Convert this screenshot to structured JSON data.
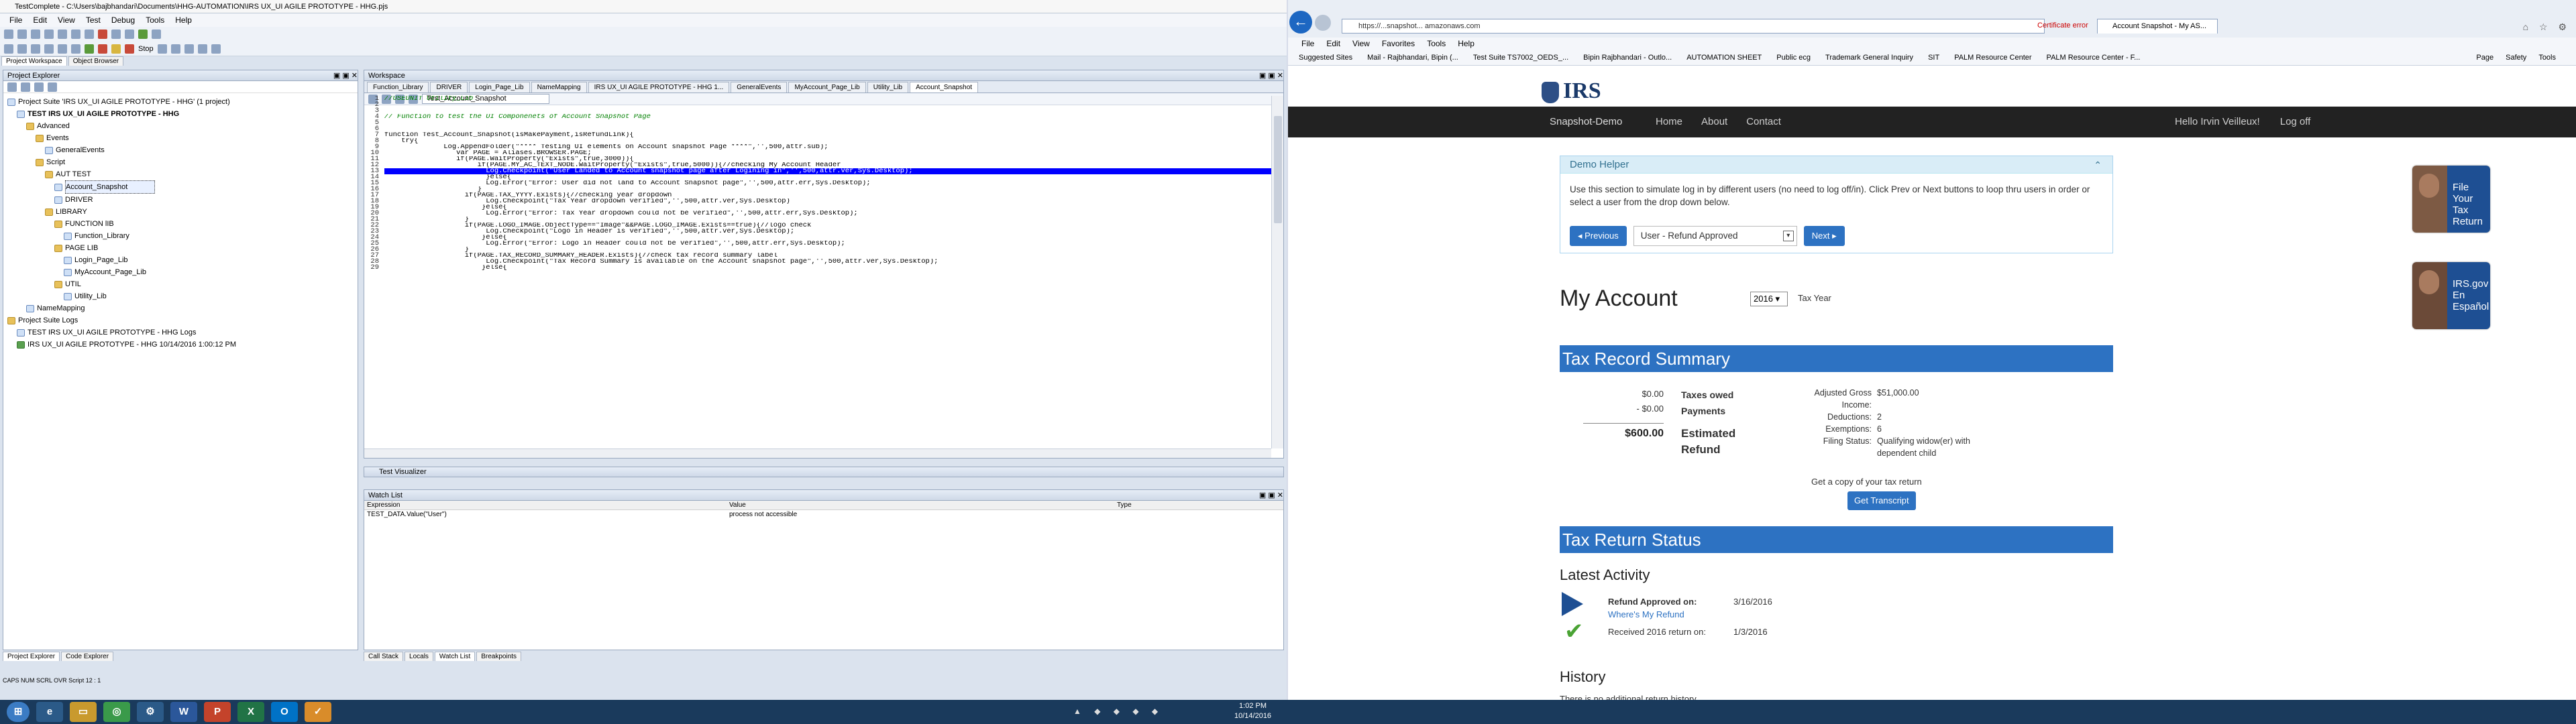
{
  "testcomplete": {
    "title": "TestComplete - C:\\Users\\bajbhandari\\Documents\\HHG-AUTOMATION\\IRS UX_UI AGILE PROTOTYPE - HHG.pjs",
    "menu": [
      "File",
      "Edit",
      "View",
      "Test",
      "Debug",
      "Tools",
      "Help"
    ],
    "stop_label": "Stop",
    "pane_tabs": [
      "Project Workspace",
      "Object Browser"
    ],
    "explorer": {
      "title": "Project Explorer",
      "tree": [
        {
          "label": "Project Suite 'IRS UX_UI AGILE PROTOTYPE - HHG' (1 project)",
          "depth": 0,
          "type": "f"
        },
        {
          "label": "TEST IRS UX_UI AGILE PROTOTYPE - HHG",
          "depth": 1,
          "type": "f",
          "bold": true
        },
        {
          "label": "Advanced",
          "depth": 2,
          "type": "d"
        },
        {
          "label": "Events",
          "depth": 3,
          "type": "d"
        },
        {
          "label": "GeneralEvents",
          "depth": 4,
          "type": "f"
        },
        {
          "label": "Script",
          "depth": 3,
          "type": "d"
        },
        {
          "label": "AUT TEST",
          "depth": 4,
          "type": "d"
        },
        {
          "label": "Account_Snapshot",
          "depth": 5,
          "type": "f",
          "selected": true
        },
        {
          "label": "DRIVER",
          "depth": 5,
          "type": "f"
        },
        {
          "label": "LIBRARY",
          "depth": 4,
          "type": "d"
        },
        {
          "label": "FUNCTION lIB",
          "depth": 5,
          "type": "d"
        },
        {
          "label": "Function_Library",
          "depth": 6,
          "type": "f"
        },
        {
          "label": "PAGE LIB",
          "depth": 5,
          "type": "d"
        },
        {
          "label": "Login_Page_Lib",
          "depth": 6,
          "type": "f"
        },
        {
          "label": "MyAccount_Page_Lib",
          "depth": 6,
          "type": "f"
        },
        {
          "label": "UTIL",
          "depth": 5,
          "type": "d"
        },
        {
          "label": "Utility_Lib",
          "depth": 6,
          "type": "f"
        },
        {
          "label": "NameMapping",
          "depth": 2,
          "type": "f"
        },
        {
          "label": "Project Suite Logs",
          "depth": 0,
          "type": "d"
        },
        {
          "label": "TEST IRS UX_UI AGILE PROTOTYPE - HHG Logs",
          "depth": 1,
          "type": "f"
        },
        {
          "label": "IRS UX_UI AGILE PROTOTYPE - HHG 10/14/2016 1:00:12 PM",
          "depth": 1,
          "type": "t"
        }
      ],
      "footer_tabs": [
        "Project Explorer",
        "Code Explorer"
      ]
    },
    "workspace": {
      "title": "Workspace",
      "tabs": [
        "Function_Library",
        "DRIVER",
        "Login_Page_Lib",
        "NameMapping",
        "IRS UX_UI AGILE PROTOTYPE - HHG 1...",
        "GeneralEvents",
        "MyAccount_Page_Lib",
        "Utility_Lib",
        "Account_Snapshot"
      ],
      "routine": "Test_Account_Snapshot",
      "code": [
        {
          "n": "1",
          "t": "//USEUNIT Utility_Lib",
          "c": true
        },
        {
          "n": "2",
          "t": ""
        },
        {
          "n": "3",
          "t": ""
        },
        {
          "n": "4",
          "t": "// Function to test the UI Componenets of Account Snapshot Page",
          "c": true
        },
        {
          "n": "5",
          "t": ""
        },
        {
          "n": "6",
          "t": ""
        },
        {
          "n": "7",
          "t": "function Test_Account_Snapshot(isMakePayment,isRefundLink){"
        },
        {
          "n": "8",
          "t": "    try{"
        },
        {
          "n": "9",
          "t": "              Log.AppendFolder(\"**** Testing UI elements on Account snapshot Page ****\",'',500,attr.sub);"
        },
        {
          "n": "10",
          "t": "                 var PAGE = Aliases.BROWSER.PAGE;"
        },
        {
          "n": "11",
          "t": "                 if(PAGE.WaitProperty(\"Exists\",true,3000)){"
        },
        {
          "n": "12",
          "t": "                      if(PAGE.MY_AC_TEXT_NODE.WaitProperty(\"Exists\",true,5000)){//checking My Account Header"
        },
        {
          "n": "13",
          "t": "                        Log.Checkpoint(\"User Landed to Account snapshot page after Logining in\",'',500,attr.ver,Sys.Desktop);",
          "hl": true
        },
        {
          "n": "14",
          "t": "                        }else{"
        },
        {
          "n": "15",
          "t": "                        Log.Error(\"Error: User did not land to Account Snapshot page\",'',500,attr.err,Sys.Desktop);"
        },
        {
          "n": "16",
          "t": "                      }"
        },
        {
          "n": "17",
          "t": "                   if(PAGE.TAX_YYYY.Exists){//checking year dropdown"
        },
        {
          "n": "18",
          "t": "                        Log.Checkpoint(\"Tax Year dropdown verified\",'',500,attr.ver,Sys.Desktop)"
        },
        {
          "n": "19",
          "t": "                       }else{"
        },
        {
          "n": "20",
          "t": "                        Log.Error(\"Error: Tax Year dropdown could not be verified\",'',500,attr.err,Sys.Desktop);"
        },
        {
          "n": "21",
          "t": "                   }"
        },
        {
          "n": "22",
          "t": "                   if(PAGE.LOGO_IMAGE.ObjectType==\"Image\"&&PAGE.LOGO_IMAGE.Exists==true){//logo check"
        },
        {
          "n": "23",
          "t": "                        Log.Checkpoint(\"Logo in Header is verified\",'',500,attr.ver,Sys.Desktop);"
        },
        {
          "n": "24",
          "t": "                       }else{"
        },
        {
          "n": "25",
          "t": "                        Log.Error(\"Error: Logo in Header could not be verified\",'',500,attr.err,Sys.Desktop);"
        },
        {
          "n": "26",
          "t": "                   }"
        },
        {
          "n": "27",
          "t": "                   if(PAGE.TAX_RECORD_SUMMARY_HEADER.Exists){//check tax record summary label"
        },
        {
          "n": "28",
          "t": "                        Log.Checkpoint(\"Tax Record Summary is available on the Account snapshot page\",'',500,attr.ver,Sys.Desktop);"
        },
        {
          "n": "29",
          "t": "                       }else{"
        }
      ]
    },
    "visualizer_title": "Test Visualizer",
    "watch": {
      "title": "Watch List",
      "columns": [
        "Expression",
        "Value",
        "Type"
      ],
      "rows": [
        {
          "expression": "TEST_DATA.Value(\"User\")",
          "value": "process not accessible",
          "type": ""
        }
      ]
    },
    "bottom_tabs": [
      "Call Stack",
      "Locals",
      "Watch List",
      "Breakpoints"
    ],
    "status": "CAPS  NUM  SCRL  OVR  Script  12 : 1"
  },
  "browser": {
    "url": "https://...snapshot... amazonaws.com",
    "cert": "Certificate error",
    "tab_title": "Account Snapshot - My AS...",
    "menu": [
      "File",
      "Edit",
      "View",
      "Favorites",
      "Tools",
      "Help"
    ],
    "favorites": [
      "Suggested Sites",
      "Mail - Rajbhandari, Bipin (...",
      "Test Suite TS7002_OEDS_...",
      "Bipin Rajbhandari - Outlo...",
      "AUTOMATION SHEET",
      "Public ecg",
      "Trademark General Inquiry",
      "SIT",
      "PALM Resource Center",
      "PALM Resource Center - F..."
    ],
    "commands": [
      "Page",
      "Safety",
      "Tools"
    ]
  },
  "page": {
    "logo": "IRS",
    "nav": {
      "brand": "Snapshot-Demo",
      "links": [
        "Home",
        "About",
        "Contact"
      ],
      "user": "Hello Irvin Veilleux!",
      "logout": "Log off"
    },
    "helper": {
      "title": "Demo Helper",
      "text": "Use this section to simulate log in by different users (no need to log off/in). Click Prev or Next buttons to loop thru users in order or select a user from the drop down below.",
      "prev": "Previous",
      "select": "User - Refund Approved",
      "next": "Next"
    },
    "promo1": "File Your Tax Return",
    "promo2": "IRS.gov En Español",
    "my_account": "My Account",
    "year": "2016",
    "year_label": "Tax Year",
    "summary_title": "Tax Record Summary",
    "amounts": {
      "owed": "$0.00",
      "payments": "- $0.00",
      "refund": "$600.00"
    },
    "labels": {
      "owed": "Taxes owed",
      "payments": "Payments",
      "refund": "Estimated Refund"
    },
    "details": [
      {
        "k": "Adjusted Gross Income:",
        "v": "$51,000.00"
      },
      {
        "k": "Deductions:",
        "v": "2"
      },
      {
        "k": "Exemptions:",
        "v": "6"
      },
      {
        "k": "Filing Status:",
        "v": "Qualifying widow(er) with dependent child"
      }
    ],
    "copy_text": "Get a copy of your tax return",
    "transcript_btn": "Get Transcript",
    "status_title": "Tax Return Status",
    "latest": "Latest Activity",
    "act1": {
      "label": "Refund Approved on:",
      "link": "Where's My Refund",
      "date": "3/16/2016"
    },
    "act2": {
      "label": "Received 2016 return on:",
      "date": "1/3/2016"
    },
    "history": "History",
    "history_none": "There is no additional return history."
  },
  "taskbar": {
    "apps": [
      "e",
      "W",
      "P",
      "X",
      "O"
    ],
    "time": "1:02 PM",
    "date": "10/14/2016"
  }
}
